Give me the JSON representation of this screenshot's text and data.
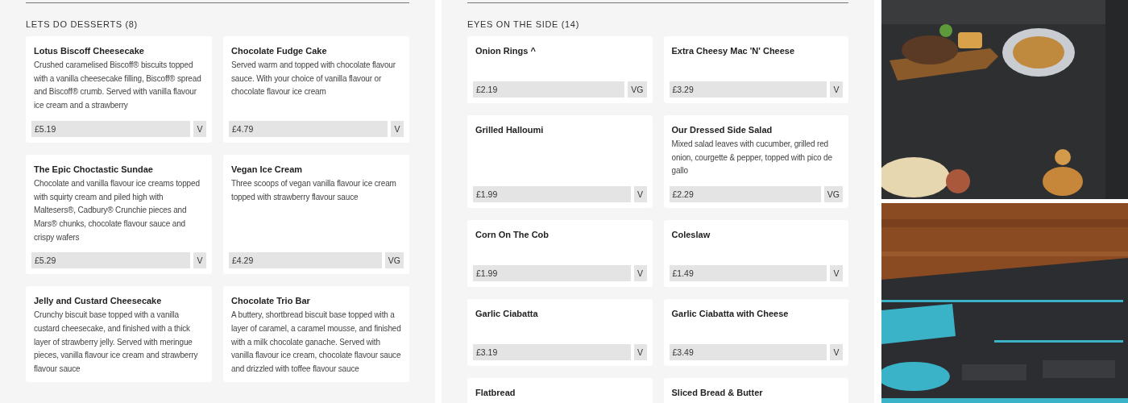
{
  "sections": [
    {
      "title": "LETS DO DESSERTS (8)",
      "items": [
        {
          "name": "Lotus Biscoff Cheesecake",
          "description": "Crushed caramelised Biscoff® biscuits topped with a vanilla cheesecake filling, Biscoff® spread and Biscoff® crumb. Served with vanilla flavour ice cream and a strawberry",
          "price": "£5.19",
          "diet": "V"
        },
        {
          "name": "Chocolate Fudge Cake",
          "description": "Served warm and topped with chocolate flavour sauce. With your choice of vanilla flavour or chocolate flavour ice cream",
          "price": "£4.79",
          "diet": "V"
        },
        {
          "name": "The Epic Choctastic Sundae",
          "description": "Chocolate and vanilla flavour ice creams topped with squirty cream and piled high with Maltesers®, Cadbury® Crunchie pieces and Mars® chunks, chocolate flavour sauce and crispy wafers",
          "price": "£5.29",
          "diet": "V"
        },
        {
          "name": "Vegan Ice Cream",
          "description": "Three scoops of vegan vanilla flavour ice cream topped with strawberry flavour sauce",
          "price": "£4.29",
          "diet": "VG"
        },
        {
          "name": "Jelly and Custard Cheesecake",
          "description": "Crunchy biscuit base topped with a vanilla custard cheesecake, and finished with a thick layer of strawberry jelly. Served with meringue pieces, vanilla flavour ice cream and strawberry flavour sauce"
        },
        {
          "name": "Chocolate Trio Bar",
          "description": "A buttery, shortbread biscuit base topped with a layer of caramel, a caramel mousse, and finished with a milk chocolate ganache. Served with vanilla flavour ice cream, chocolate flavour sauce and drizzled with toffee flavour sauce"
        }
      ]
    },
    {
      "title": "EYES ON THE SIDE (14)",
      "items": [
        {
          "name": "Onion Rings ^",
          "price": "£2.19",
          "diet": "VG"
        },
        {
          "name": "Extra Cheesy Mac 'N' Cheese",
          "price": "£3.29",
          "diet": "V"
        },
        {
          "name": "Grilled Halloumi",
          "price": "£1.99",
          "diet": "V"
        },
        {
          "name": "Our Dressed Side Salad",
          "description": "Mixed salad leaves with cucumber, grilled red onion, courgette & pepper, topped with pico de gallo",
          "price": "£2.29",
          "diet": "VG"
        },
        {
          "name": "Corn On The Cob",
          "price": "£1.99",
          "diet": "V"
        },
        {
          "name": "Coleslaw",
          "price": "£1.49",
          "diet": "V"
        },
        {
          "name": "Garlic Ciabatta",
          "price": "£3.19",
          "diet": "V"
        },
        {
          "name": "Garlic Ciabatta with Cheese",
          "price": "£3.49",
          "diet": "V"
        },
        {
          "name": "Flatbread"
        },
        {
          "name": "Sliced Bread & Butter"
        }
      ]
    }
  ]
}
